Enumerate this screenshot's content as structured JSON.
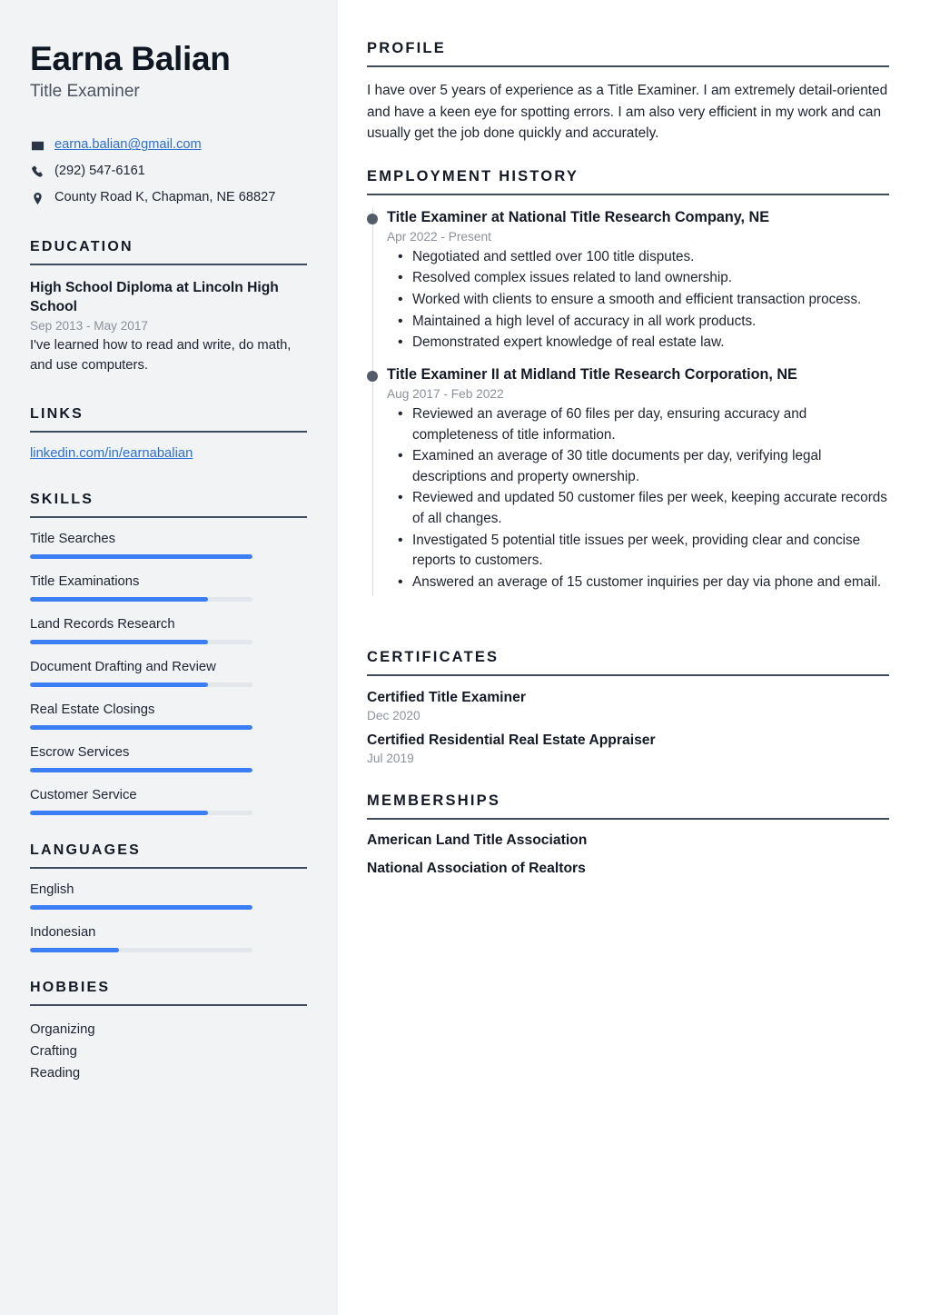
{
  "sidebar": {
    "name": "Earna Balian",
    "job_title": "Title Examiner",
    "contact": {
      "email": "earna.balian@gmail.com",
      "phone": "(292) 547-6161",
      "address": "County Road K, Chapman, NE 68827",
      "email_icon": "envelope-icon",
      "phone_icon": "phone-icon",
      "address_icon": "map-pin-icon"
    },
    "education": {
      "heading": "EDUCATION",
      "items": [
        {
          "title": "High School Diploma at Lincoln High School",
          "date": "Sep 2013 - May 2017",
          "description": "I've learned how to read and write, do math, and use computers."
        }
      ]
    },
    "links": {
      "heading": "LINKS",
      "items": [
        {
          "label": "linkedin.com/in/earnabalian"
        }
      ]
    },
    "skills": {
      "heading": "SKILLS",
      "items": [
        {
          "label": "Title Searches",
          "level": 100
        },
        {
          "label": "Title Examinations",
          "level": 80
        },
        {
          "label": "Land Records Research",
          "level": 80
        },
        {
          "label": "Document Drafting and Review",
          "level": 80
        },
        {
          "label": "Real Estate Closings",
          "level": 100
        },
        {
          "label": "Escrow Services",
          "level": 100
        },
        {
          "label": "Customer Service",
          "level": 80
        }
      ]
    },
    "languages": {
      "heading": "LANGUAGES",
      "items": [
        {
          "label": "English",
          "level": 100
        },
        {
          "label": "Indonesian",
          "level": 40
        }
      ]
    },
    "hobbies": {
      "heading": "HOBBIES",
      "items": [
        {
          "label": "Organizing"
        },
        {
          "label": "Crafting"
        },
        {
          "label": "Reading"
        }
      ]
    }
  },
  "main": {
    "profile": {
      "heading": "PROFILE",
      "text": "I have over 5 years of experience as a Title Examiner. I am extremely detail-oriented and have a keen eye for spotting errors. I am also very efficient in my work and can usually get the job done quickly and accurately."
    },
    "employment": {
      "heading": "EMPLOYMENT HISTORY",
      "jobs": [
        {
          "title": "Title Examiner at National Title Research Company, NE",
          "date": "Apr 2022 - Present",
          "bullets": [
            "Negotiated and settled over 100 title disputes.",
            "Resolved complex issues related to land ownership.",
            "Worked with clients to ensure a smooth and efficient transaction process.",
            "Maintained a high level of accuracy in all work products.",
            "Demonstrated expert knowledge of real estate law."
          ]
        },
        {
          "title": "Title Examiner II at Midland Title Research Corporation, NE",
          "date": "Aug 2017 - Feb 2022",
          "bullets": [
            "Reviewed an average of 60 files per day, ensuring accuracy and completeness of title information.",
            "Examined an average of 30 title documents per day, verifying legal descriptions and property ownership.",
            "Reviewed and updated 50 customer files per week, keeping accurate records of all changes.",
            "Investigated 5 potential title issues per week, providing clear and concise reports to customers.",
            "Answered an average of 15 customer inquiries per day via phone and email."
          ]
        }
      ]
    },
    "certificates": {
      "heading": "CERTIFICATES",
      "items": [
        {
          "title": "Certified Title Examiner",
          "date": "Dec 2020"
        },
        {
          "title": "Certified Residential Real Estate Appraiser",
          "date": "Jul 2019"
        }
      ]
    },
    "memberships": {
      "heading": "MEMBERSHIPS",
      "items": [
        {
          "label": "American Land Title Association"
        },
        {
          "label": "National Association of Realtors"
        }
      ]
    }
  },
  "colors": {
    "accent": "#3b7ef3",
    "link": "#2b6fd4",
    "sidebar_bg": "#f1f3f5",
    "heading": "#131a26",
    "rule": "#3f4a5a",
    "muted": "#8b919c"
  }
}
